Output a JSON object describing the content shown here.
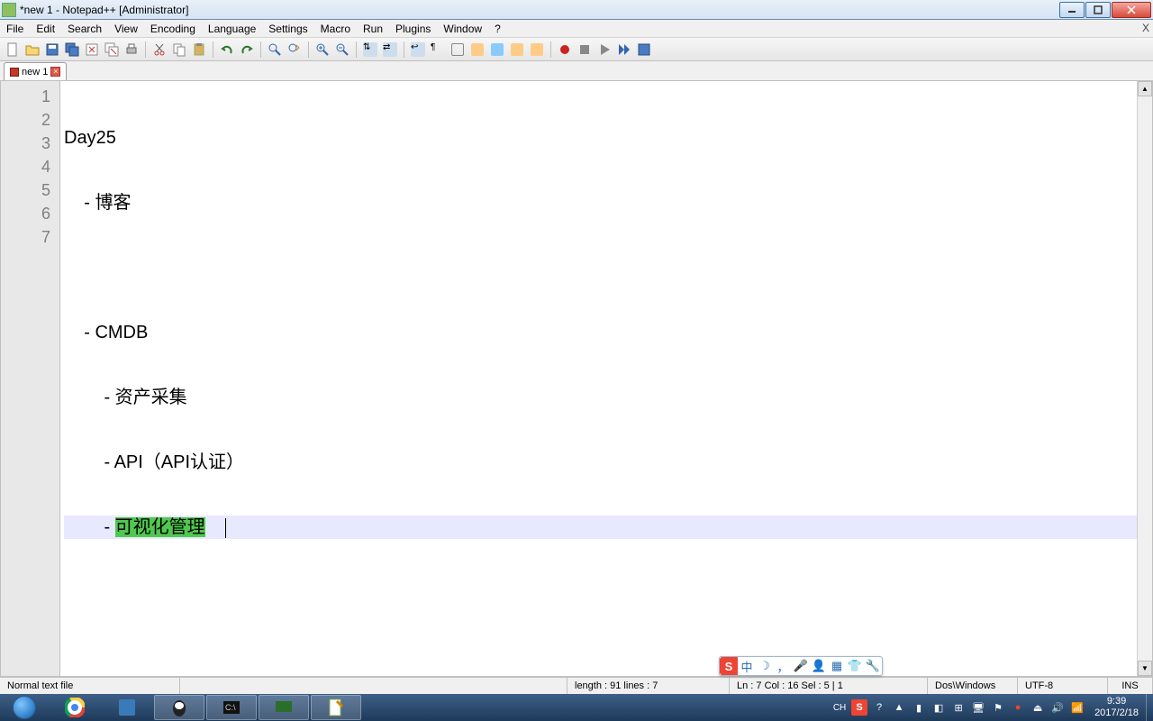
{
  "window": {
    "title": "*new 1 - Notepad++ [Administrator]"
  },
  "menu": {
    "file": "File",
    "edit": "Edit",
    "search": "Search",
    "view": "View",
    "encoding": "Encoding",
    "language": "Language",
    "settings": "Settings",
    "macro": "Macro",
    "run": "Run",
    "plugins": "Plugins",
    "window": "Window",
    "help": "?"
  },
  "tab": {
    "name": "new 1"
  },
  "lines": {
    "l1": "Day25",
    "l2": "    - 博客",
    "l3": "",
    "l4": "    - CMDB",
    "l5": "        - 资产采集",
    "l6": "        - API（API认证）",
    "l7_prefix": "        - ",
    "l7_hl": "可视化管理"
  },
  "linenums": {
    "n1": "1",
    "n2": "2",
    "n3": "3",
    "n4": "4",
    "n5": "5",
    "n6": "6",
    "n7": "7"
  },
  "status": {
    "type": "Normal text file",
    "length": "length : 91    lines : 7",
    "pos": "Ln : 7    Col : 16    Sel : 5 | 1",
    "eol": "Dos\\Windows",
    "enc": "UTF-8",
    "ins": "INS"
  },
  "ime": {
    "logo": "S",
    "lang": "中",
    "moon": "☽",
    "comma": "，",
    "mic": "🎤",
    "profile": "👤",
    "tile": "▦",
    "shirt": "👕",
    "tool": "🔧"
  },
  "tray": {
    "lang": "CH",
    "s": "S",
    "time": "9:39",
    "date": "2017/2/18"
  }
}
